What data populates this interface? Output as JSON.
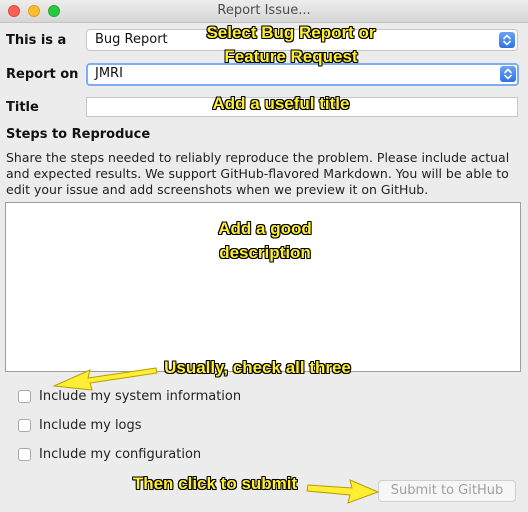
{
  "window": {
    "title": "Report Issue..."
  },
  "form": {
    "type_label": "This is a",
    "type_value": "Bug Report",
    "target_label": "Report on",
    "target_value": "JMRI",
    "title_label": "Title",
    "title_value": "",
    "steps_heading": "Steps to Reproduce",
    "steps_help_1": "Share the steps needed to reliably reproduce the problem. Please include actual",
    "steps_help_2": "and expected results. We support GitHub-flavored Markdown. You will be able to",
    "steps_help_3": "edit your issue and add screenshots when we preview it on GitHub.",
    "description_value": "",
    "checkboxes": [
      {
        "label": "Include my system information",
        "checked": false
      },
      {
        "label": "Include my logs",
        "checked": false
      },
      {
        "label": "Include my configuration",
        "checked": false
      }
    ],
    "submit_label": "Submit to GitHub"
  },
  "annotations": {
    "select_1": "Select Bug Report or",
    "select_2": "Feature Request",
    "title_hint": "Add a useful title",
    "desc_1": "Add a good",
    "desc_2": "description",
    "check_hint": "Usually, check all three",
    "submit_hint": "Then click to submit"
  },
  "colors": {
    "annotation_text": "#ffee33",
    "annotation_arrow": "#ffee33",
    "focus_ring": "#7eaef1",
    "stepper_blue": "#2f72e6"
  }
}
